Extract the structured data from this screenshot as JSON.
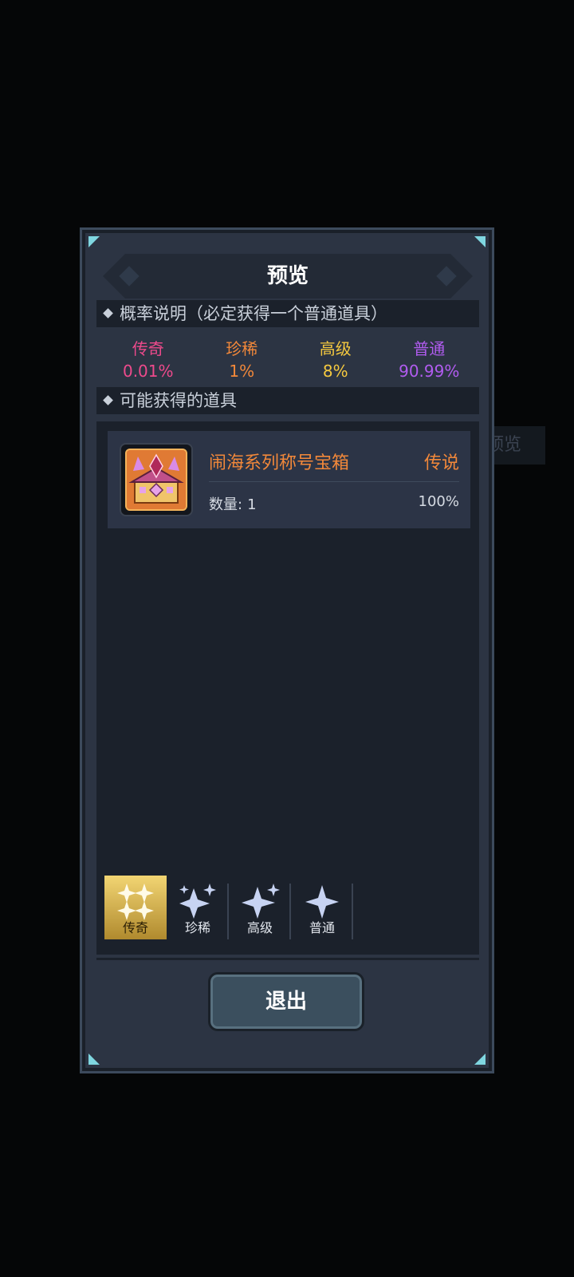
{
  "background": {
    "ghost_text": "预览"
  },
  "dialog": {
    "title": "预览",
    "probability_section": {
      "label": "概率说明（必定获得一个普通道具）"
    },
    "rates": [
      {
        "name": "传奇",
        "value": "0.01%",
        "color": "#ee4a8c"
      },
      {
        "name": "珍稀",
        "value": "1%",
        "color": "#f2883a"
      },
      {
        "name": "高级",
        "value": "8%",
        "color": "#f5c93f"
      },
      {
        "name": "普通",
        "value": "90.99%",
        "color": "#b15cf0"
      }
    ],
    "items_section": {
      "label": "可能获得的道具"
    },
    "items": [
      {
        "name": "闹海系列称号宝箱",
        "rarity": "传说",
        "quantity_label": "数量:",
        "quantity": "1",
        "probability": "100%",
        "icon": "treasure-chest-icon"
      }
    ],
    "filters": [
      {
        "label": "传奇",
        "icon": "sparkle-quad-icon",
        "active": true
      },
      {
        "label": "珍稀",
        "icon": "sparkle-triple-icon",
        "active": false
      },
      {
        "label": "高级",
        "icon": "sparkle-double-icon",
        "active": false
      },
      {
        "label": "普通",
        "icon": "sparkle-single-icon",
        "active": false
      }
    ],
    "exit_label": "退出"
  }
}
